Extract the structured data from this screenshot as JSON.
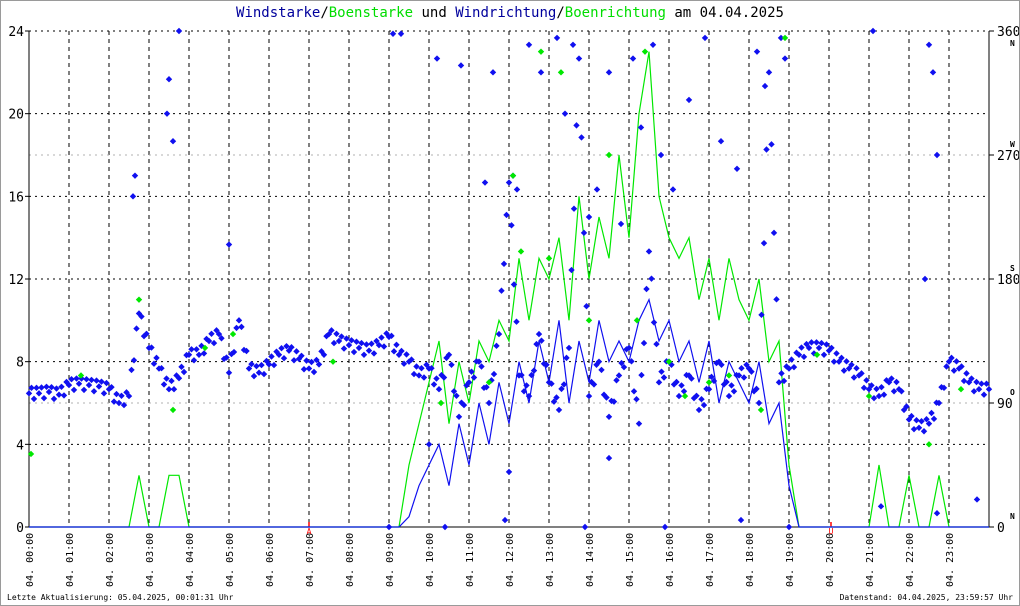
{
  "title": {
    "wind_speed": "Windstarke",
    "sep1": "/",
    "gust_speed": "Boenstarke",
    "und": " und ",
    "wind_dir": "Windrichtung",
    "sep2": "/",
    "gust_dir": "Boenrichtung",
    "date_part": " am 04.04.2025"
  },
  "footer": {
    "left": "Letzte Aktualisierung: 05.04.2025, 00:01:31 Uhr",
    "right": "Datenstand: 04.04.2025, 23:59:57 Uhr"
  },
  "colors": {
    "wind": "#1010f0",
    "gust": "#00e800",
    "grid": "#000000",
    "grid_gray": "#b0b0b0",
    "sun": "#ff0000"
  },
  "chart_data": {
    "type": "line+scatter",
    "title": "Windstarke/Boenstarke und Windrichtung/Boenrichtung am 04.04.2025",
    "xlim": [
      0,
      24
    ],
    "ylim_left": [
      0,
      24
    ],
    "ylim_right": [
      0,
      360
    ],
    "left_ticks": [
      "0",
      "4",
      "8",
      "12",
      "16",
      "20",
      "24"
    ],
    "right_ticks": [
      "0",
      "90",
      "180",
      "270",
      "360"
    ],
    "compass": [
      {
        "label": "N",
        "deg": 360,
        "below": true
      },
      {
        "label": "W",
        "deg": 270
      },
      {
        "label": "S",
        "deg": 180
      },
      {
        "label": "O",
        "deg": 90
      },
      {
        "label": "N",
        "deg": 0
      }
    ],
    "x_tick_labels": [
      "04. 00:00",
      "04. 01:00",
      "04. 02:00",
      "04. 03:00",
      "04. 04:00",
      "04. 05:00",
      "04. 06:00",
      "04. 07:00",
      "04. 08:00",
      "04. 09:00",
      "04. 10:00",
      "04. 11:00",
      "04. 12:00",
      "04. 13:00",
      "04. 14:00",
      "04. 15:00",
      "04. 16:00",
      "04. 17:00",
      "04. 18:00",
      "04. 19:00",
      "04. 20:00",
      "04. 21:00",
      "04. 22:00",
      "04. 23:00"
    ],
    "sun_markers": [
      {
        "label": "A",
        "hour": 7.0
      },
      {
        "label": "U",
        "hour": 20.05
      }
    ],
    "step_hours": 0.25,
    "wind_speed": [
      0,
      0,
      0,
      0,
      0,
      0,
      0,
      0,
      0,
      0,
      0,
      0,
      0,
      0,
      0,
      0,
      0,
      0,
      0,
      0,
      0,
      0,
      0,
      0,
      0,
      0,
      0,
      0,
      0,
      0,
      0,
      0,
      0,
      0,
      0,
      0,
      0,
      0,
      0.5,
      2,
      3,
      4,
      2,
      5,
      3,
      6,
      4,
      7,
      5,
      8,
      6,
      9,
      7,
      10,
      6,
      9,
      7,
      10,
      8,
      9,
      8,
      10,
      11,
      9,
      10,
      8,
      9,
      7,
      9,
      6,
      8,
      7,
      6,
      8,
      5,
      6,
      2,
      0,
      0,
      0,
      0,
      0,
      0,
      0,
      0,
      0,
      0,
      0,
      0,
      0,
      0,
      0,
      0,
      0,
      0,
      0,
      0
    ],
    "gust_speed": [
      0,
      0,
      0,
      0,
      0,
      0,
      0,
      0,
      0,
      0,
      0,
      2.5,
      0,
      0,
      2.5,
      2.5,
      0,
      0,
      0,
      0,
      0,
      0,
      0,
      0,
      0,
      0,
      0,
      0,
      0,
      0,
      0,
      0,
      0,
      0,
      0,
      0,
      0,
      0,
      3,
      5,
      7,
      9,
      5,
      8,
      6,
      9,
      8,
      10,
      9,
      13,
      10,
      13,
      12,
      14,
      10,
      16,
      12,
      15,
      13,
      18,
      14,
      20,
      23,
      16,
      14,
      13,
      14,
      11,
      13,
      10,
      13,
      11,
      10,
      12,
      8,
      9,
      3,
      0,
      0,
      0,
      0,
      0,
      0,
      0,
      0,
      3,
      0,
      0,
      2.5,
      0,
      0,
      2.5,
      0,
      0,
      0,
      0,
      0
    ],
    "wind_dir": [
      97,
      97,
      98,
      96,
      103,
      104,
      103,
      102,
      100,
      90,
      95,
      155,
      130,
      115,
      100,
      108,
      125,
      125,
      135,
      140,
      112,
      150,
      115,
      112,
      118,
      125,
      128,
      122,
      115,
      118,
      140,
      135,
      132,
      130,
      128,
      132,
      138,
      125,
      120,
      110,
      115,
      100,
      125,
      80,
      105,
      120,
      90,
      140,
      250,
      110,
      95,
      140,
      105,
      85,
      130,
      340,
      95,
      120,
      80,
      110,
      130,
      75,
      200,
      105,
      120,
      95,
      110,
      85,
      100,
      120,
      95,
      110,
      115,
      90,
      330,
      105,
      115,
      125,
      130,
      130,
      128,
      120,
      115,
      110,
      100,
      95,
      105,
      100,
      78,
      72,
      75,
      90,
      120,
      115,
      105,
      100,
      100
    ],
    "wind_dir_extra": [
      [
        2.6,
        240
      ],
      [
        2.65,
        255
      ],
      [
        3.45,
        300
      ],
      [
        3.5,
        325
      ],
      [
        3.6,
        280
      ],
      [
        3.75,
        360
      ],
      [
        5.0,
        205
      ],
      [
        9.1,
        358
      ],
      [
        9.3,
        358
      ],
      [
        10.2,
        340
      ],
      [
        10.8,
        335
      ],
      [
        11.4,
        250
      ],
      [
        11.6,
        330
      ],
      [
        12.1,
        255
      ],
      [
        12.2,
        245
      ],
      [
        12.5,
        350
      ],
      [
        12.8,
        330
      ],
      [
        13.2,
        355
      ],
      [
        13.4,
        300
      ],
      [
        13.6,
        350
      ],
      [
        14.0,
        225
      ],
      [
        14.2,
        245
      ],
      [
        14.5,
        330
      ],
      [
        14.8,
        220
      ],
      [
        15.1,
        340
      ],
      [
        15.3,
        290
      ],
      [
        15.6,
        350
      ],
      [
        15.8,
        270
      ],
      [
        16.1,
        245
      ],
      [
        16.5,
        310
      ],
      [
        16.9,
        355
      ],
      [
        17.3,
        280
      ],
      [
        17.7,
        260
      ],
      [
        18.2,
        345
      ],
      [
        18.4,
        320
      ],
      [
        18.8,
        355
      ],
      [
        18.9,
        340
      ],
      [
        21.1,
        360
      ],
      [
        22.5,
        350
      ],
      [
        22.6,
        330
      ],
      [
        22.7,
        270
      ],
      [
        22.4,
        180
      ],
      [
        21.3,
        15
      ],
      [
        22.7,
        10
      ],
      [
        23.7,
        20
      ],
      [
        10.0,
        60
      ],
      [
        12.0,
        40
      ],
      [
        14.5,
        50
      ],
      [
        9.0,
        0
      ],
      [
        10.4,
        0
      ],
      [
        11.9,
        5
      ],
      [
        13.9,
        0
      ],
      [
        15.9,
        0
      ],
      [
        17.8,
        5
      ],
      [
        19.0,
        0
      ]
    ],
    "gust_dir": [
      [
        0.05,
        53
      ],
      [
        1.3,
        110
      ],
      [
        2.75,
        165
      ],
      [
        3.6,
        85
      ],
      [
        4.4,
        130
      ],
      [
        5.1,
        140
      ],
      [
        7.6,
        120
      ],
      [
        10.3,
        90
      ],
      [
        11.5,
        105
      ],
      [
        12.1,
        255
      ],
      [
        12.3,
        200
      ],
      [
        12.8,
        345
      ],
      [
        13.0,
        195
      ],
      [
        13.3,
        330
      ],
      [
        14.0,
        150
      ],
      [
        14.5,
        270
      ],
      [
        15.2,
        150
      ],
      [
        15.4,
        345
      ],
      [
        16.0,
        120
      ],
      [
        16.4,
        95
      ],
      [
        17.0,
        105
      ],
      [
        17.5,
        110
      ],
      [
        18.3,
        85
      ],
      [
        18.9,
        355
      ],
      [
        19.7,
        125
      ],
      [
        21.0,
        95
      ],
      [
        22.5,
        60
      ],
      [
        23.3,
        100
      ]
    ]
  }
}
